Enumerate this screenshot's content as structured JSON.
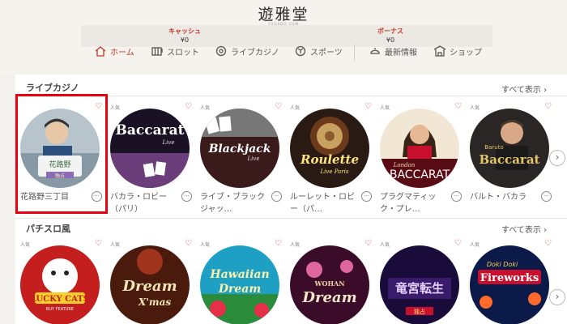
{
  "logo": {
    "text": "遊雅堂",
    "sub": "YUGADO.COM"
  },
  "balance": {
    "cash_label": "キャッシュ",
    "cash_value": "¥0",
    "bonus_label": "ボーナス",
    "bonus_value": "¥0"
  },
  "nav": [
    {
      "label": "ホーム",
      "icon": "home-icon"
    },
    {
      "label": "スロット",
      "icon": "slot-icon"
    },
    {
      "label": "ライブカジノ",
      "icon": "live-casino-icon"
    },
    {
      "label": "スポーツ",
      "icon": "sports-icon"
    },
    {
      "label": "最新情報",
      "icon": "news-icon"
    },
    {
      "label": "ショップ",
      "icon": "shop-icon"
    }
  ],
  "colors": {
    "accent": "#c0392b",
    "highlight": "#e60012"
  },
  "sections": [
    {
      "title": "ライブカジノ",
      "see_all": "すべて表示",
      "cards": [
        {
          "badge": "",
          "caption": "花路野三丁目",
          "thumb_text": "花路野",
          "thumb_sub": "独占"
        },
        {
          "badge": "人気",
          "caption": "バカラ・ロビー（パリ）",
          "thumb_text": "Baccarat",
          "thumb_sub": "Live"
        },
        {
          "badge": "人気",
          "caption": "ライブ・ブラックジャッ…",
          "thumb_text": "Blackjack",
          "thumb_sub": "Live"
        },
        {
          "badge": "人気",
          "caption": "ルーレット・ロビー（パ…",
          "thumb_text": "Roulette",
          "thumb_sub": "Live Paris"
        },
        {
          "badge": "人気",
          "caption": "プラグマティック・プレ…",
          "thumb_text": "BACCARAT",
          "thumb_sub": "London"
        },
        {
          "badge": "人気",
          "caption": "バルト・バカラ",
          "thumb_text": "Baccarat",
          "thumb_sub": "Baruto"
        }
      ]
    },
    {
      "title": "パチスロ風",
      "see_all": "すべて表示",
      "cards": [
        {
          "badge": "人気",
          "thumb_text": "LUCKY CATS",
          "thumb_sub": "BUY FEATURE"
        },
        {
          "badge": "人気",
          "thumb_text": "Dream",
          "thumb_sub": "X'mas"
        },
        {
          "badge": "人気",
          "thumb_text": "Hawaiian",
          "thumb_sub": "Dream"
        },
        {
          "badge": "人気",
          "thumb_text": "Dream",
          "thumb_sub": "WOHAN"
        },
        {
          "badge": "人気",
          "thumb_text": "竜宮転生",
          "thumb_sub": "独占"
        },
        {
          "badge": "人気",
          "thumb_text": "Fireworks",
          "thumb_sub": "Doki Doki"
        }
      ]
    }
  ]
}
